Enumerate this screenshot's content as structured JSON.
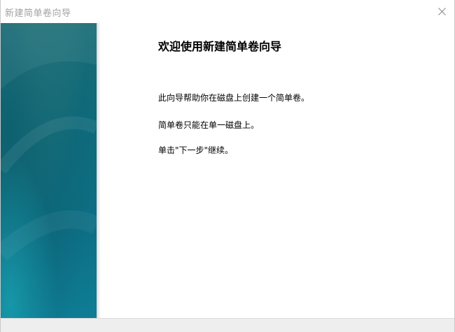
{
  "window": {
    "title": "新建简单卷向导",
    "close_icon": "close-icon"
  },
  "banner": {
    "colors": [
      "#1f6f76",
      "#0f6a79",
      "#0d6e84",
      "#0f7d96"
    ]
  },
  "content": {
    "heading": "欢迎使用新建简单卷向导",
    "paragraph_1": "此向导帮助你在磁盘上创建一个简单卷。",
    "paragraph_2": "简单卷只能在单一磁盘上。",
    "paragraph_3": "单击\"下一步\"继续。"
  }
}
